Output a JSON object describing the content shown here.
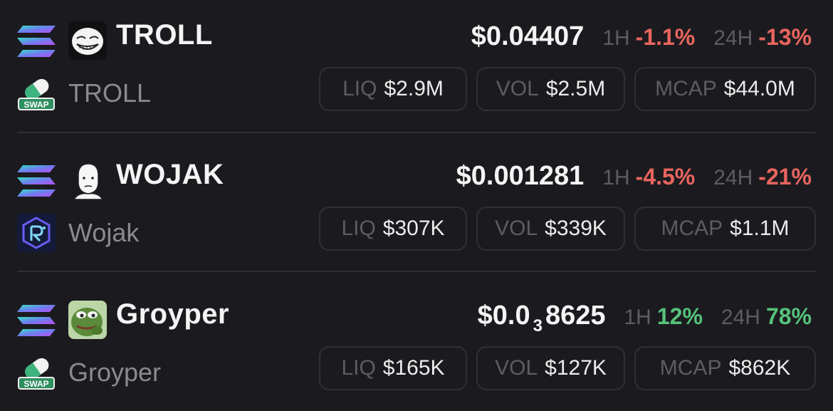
{
  "tokens": [
    {
      "ticker": "TROLL",
      "name": "TROLL",
      "chain_icon": "solana-icon",
      "token_icon": "troll-face-icon",
      "dex_icon": "swap-pill-icon",
      "price": "$0.04407",
      "price_subscript": "",
      "price_tail": "",
      "h1_label": "1H",
      "h1_change": "-1.1%",
      "h1_direction": "down",
      "h24_label": "24H",
      "h24_change": "-13%",
      "h24_direction": "down",
      "liq_label": "LIQ",
      "liq_value": "$2.9M",
      "vol_label": "VOL",
      "vol_value": "$2.5M",
      "mcap_label": "MCAP",
      "mcap_value": "$44.0M"
    },
    {
      "ticker": "WOJAK",
      "name": "Wojak",
      "chain_icon": "solana-icon",
      "token_icon": "wojak-face-icon",
      "dex_icon": "raydium-icon",
      "price": "$0.001281",
      "price_subscript": "",
      "price_tail": "",
      "h1_label": "1H",
      "h1_change": "-4.5%",
      "h1_direction": "down",
      "h24_label": "24H",
      "h24_change": "-21%",
      "h24_direction": "down",
      "liq_label": "LIQ",
      "liq_value": "$307K",
      "vol_label": "VOL",
      "vol_value": "$339K",
      "mcap_label": "MCAP",
      "mcap_value": "$1.1M"
    },
    {
      "ticker": "Groyper",
      "name": "Groyper",
      "chain_icon": "solana-icon",
      "token_icon": "groyper-frog-icon",
      "dex_icon": "swap-pill-icon",
      "price": "$0.0",
      "price_subscript": "3",
      "price_tail": "8625",
      "h1_label": "1H",
      "h1_change": "12%",
      "h1_direction": "up",
      "h24_label": "24H",
      "h24_change": "78%",
      "h24_direction": "up",
      "liq_label": "LIQ",
      "liq_value": "$165K",
      "vol_label": "VOL",
      "vol_value": "$127K",
      "mcap_label": "MCAP",
      "mcap_value": "$862K"
    }
  ],
  "colors": {
    "background": "#1b1b1f",
    "negative": "#e8655e",
    "positive": "#56c27a",
    "muted": "#5c5c62",
    "pill_border": "#2f2f36"
  },
  "dex_badge_text": "SWAP"
}
